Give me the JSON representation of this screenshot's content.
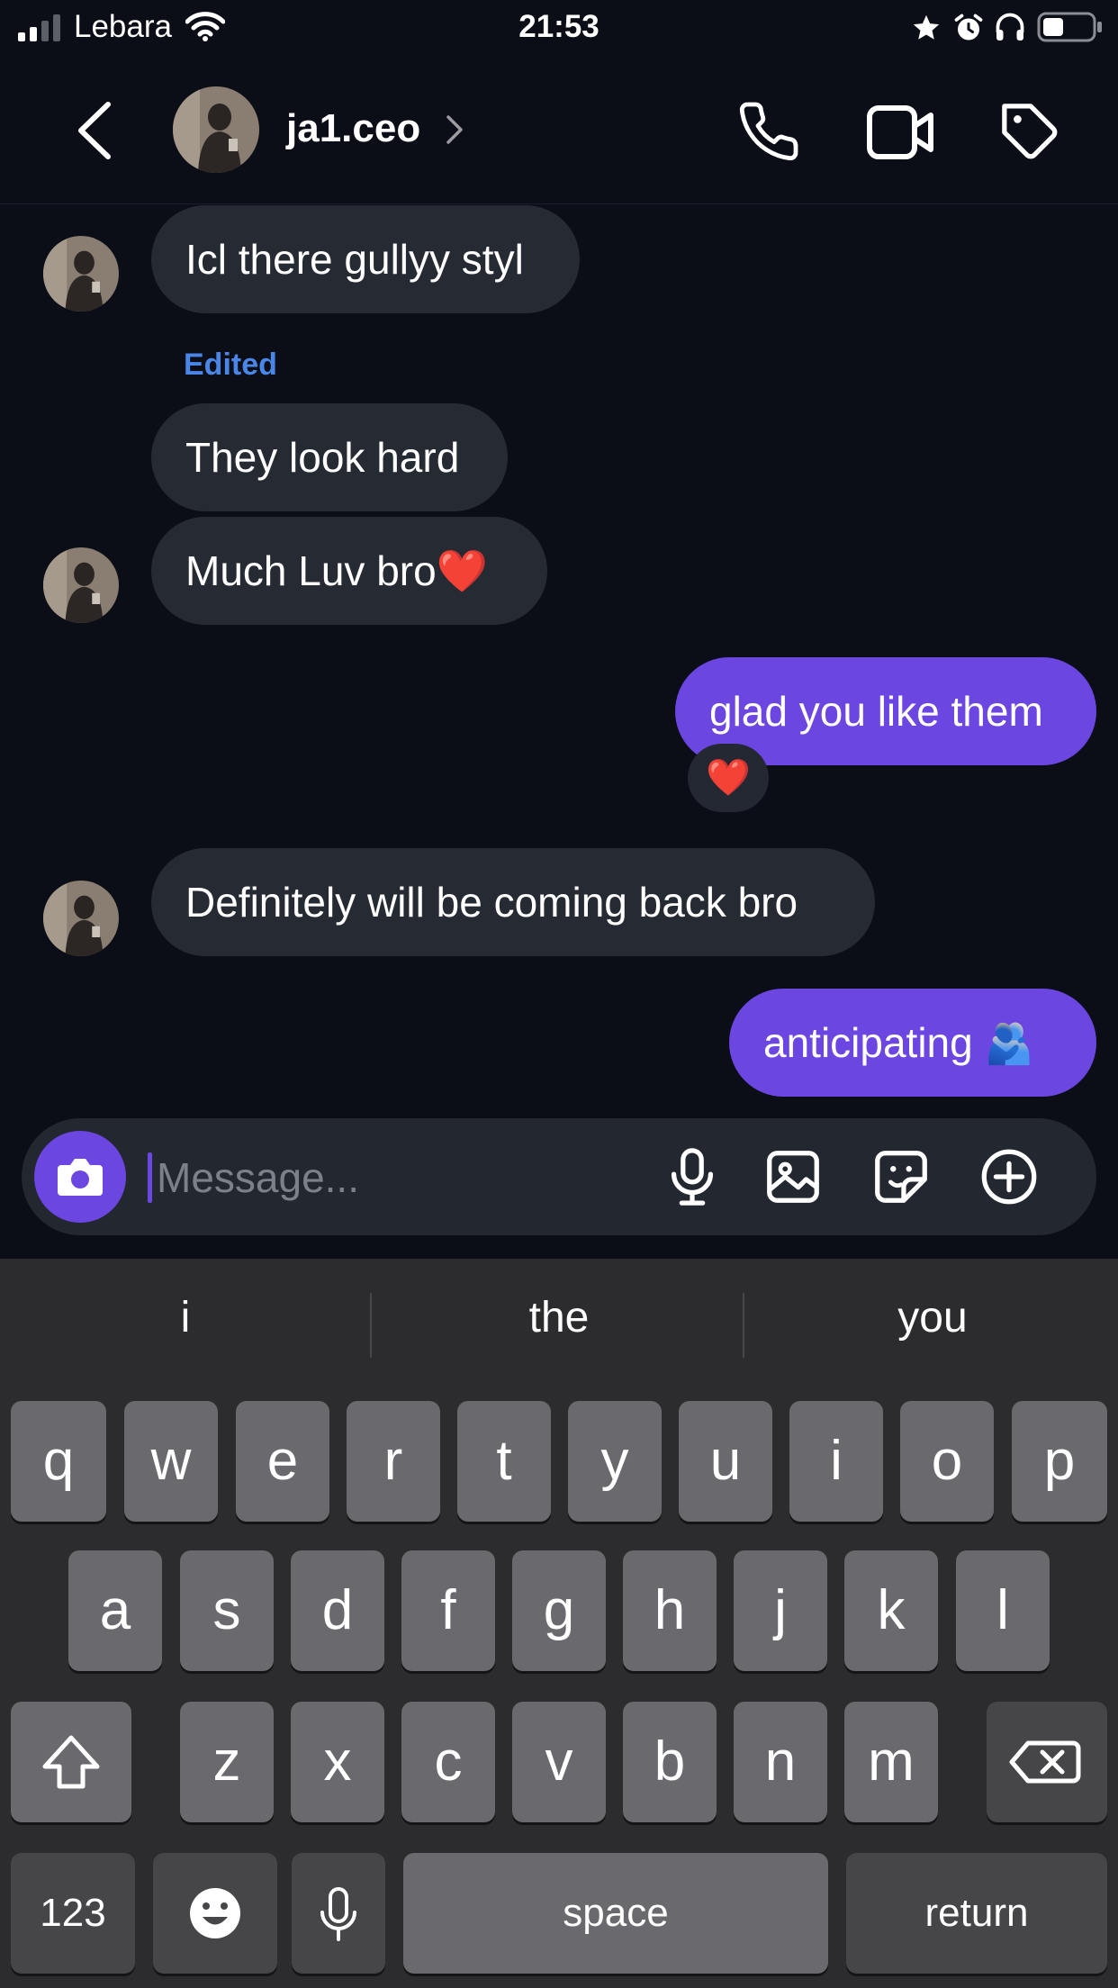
{
  "status_bar": {
    "carrier": "Lebara",
    "time": "21:53"
  },
  "header": {
    "username": "ja1.ceo"
  },
  "messages": [
    {
      "direction": "in",
      "text": "Icl there gullyy styl"
    },
    {
      "direction": "in",
      "label": "Edited",
      "text": "They look hard"
    },
    {
      "direction": "in",
      "text": "Much Luv bro",
      "emoji": "❤️"
    },
    {
      "direction": "out",
      "text": "glad you like them",
      "reaction": "❤️"
    },
    {
      "direction": "in",
      "text": "Definitely will be coming back bro"
    },
    {
      "direction": "out",
      "text": "anticipating",
      "emoji": "🫂"
    }
  ],
  "composer": {
    "placeholder": "Message..."
  },
  "keyboard": {
    "suggestions": [
      "i",
      "the",
      "you"
    ],
    "row1": [
      "q",
      "w",
      "e",
      "r",
      "t",
      "y",
      "u",
      "i",
      "o",
      "p"
    ],
    "row2": [
      "a",
      "s",
      "d",
      "f",
      "g",
      "h",
      "j",
      "k",
      "l"
    ],
    "row3": [
      "z",
      "x",
      "c",
      "v",
      "b",
      "n",
      "m"
    ],
    "numbers_key": "123",
    "space_key": "space",
    "return_key": "return"
  },
  "colors": {
    "background": "#0b0e16",
    "incoming_bubble": "#262a33",
    "outgoing_bubble": "#6c46e0",
    "edited_label": "#4a86e8",
    "keyboard_bg": "#2c2c2e",
    "key": "#6a6a6e"
  }
}
